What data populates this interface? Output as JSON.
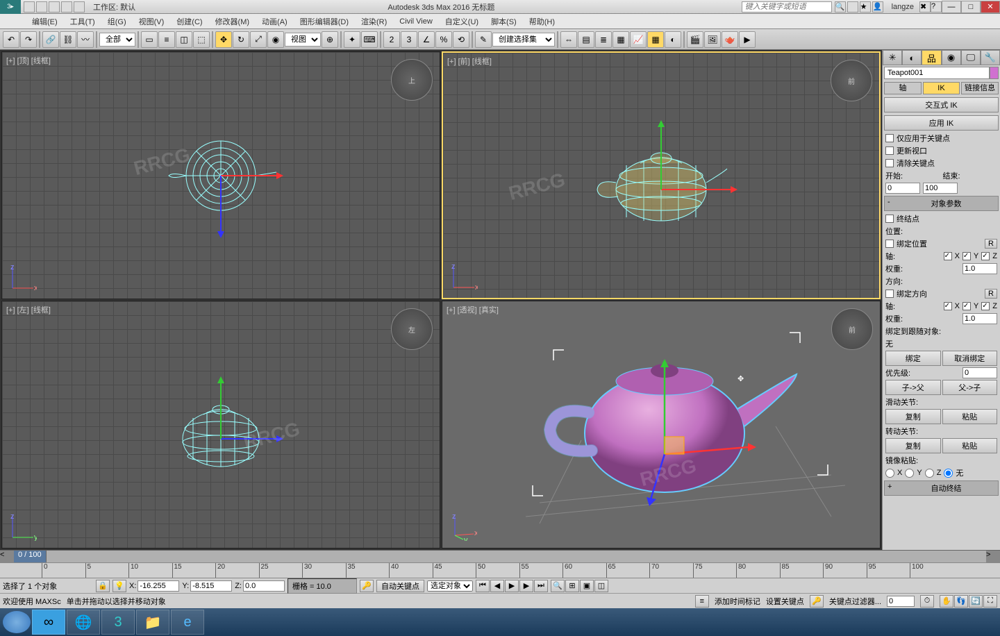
{
  "titlebar": {
    "workspace_label": "工作区: 默认",
    "app_title": "Autodesk 3ds Max 2016    无标题",
    "search_placeholder": "键入关键字或短语",
    "username": "langze"
  },
  "menu": [
    "编辑(E)",
    "工具(T)",
    "组(G)",
    "视图(V)",
    "创建(C)",
    "修改器(M)",
    "动画(A)",
    "图形编辑器(D)",
    "渲染(R)",
    "Civil View",
    "自定义(U)",
    "脚本(S)",
    "帮助(H)"
  ],
  "toolbar": {
    "filter": "全部",
    "view_dropdown": "视图",
    "selection_set": "创建选择集"
  },
  "viewports": {
    "top": "[+] [顶] [线框]",
    "front": "[+] [前] [线框]",
    "left": "[+] [左] [线框]",
    "persp": "[+] [透视] [真实]",
    "cube_front": "前",
    "cube_left": "左",
    "cube_top": "上"
  },
  "panel": {
    "object_name": "Teapot001",
    "subtabs": {
      "pivot": "轴",
      "ik": "IK",
      "link": "链接信息"
    },
    "interactive_ik": "交互式 IK",
    "apply_ik": "应用 IK",
    "only_keyframes": "仅应用于关键点",
    "update_viewport": "更新视口",
    "clear_keys": "清除关键点",
    "start": "开始:",
    "start_val": "0",
    "end": "结束:",
    "end_val": "100",
    "obj_params": "对象参数",
    "terminator": "终结点",
    "position": "位置:",
    "bind_pos": "绑定位置",
    "axis": "轴:",
    "weight": "权重:",
    "weight_val": "1.0",
    "orientation": "方向:",
    "bind_orient": "绑定方向",
    "bind_follow": "绑定到跟随对象:",
    "none": "无",
    "bind": "绑定",
    "unbind": "取消绑定",
    "priority": "优先级:",
    "priority_val": "0",
    "child_parent": "子->父",
    "parent_child": "父->子",
    "sliding_joint": "滑动关节:",
    "copy": "复制",
    "paste": "粘贴",
    "rotation_joint": "转动关节:",
    "mirror_paste": "镜像粘贴:",
    "auto_terminate": "自动终结",
    "r_btn": "R"
  },
  "timeline": {
    "current": "0 / 100",
    "ticks": [
      0,
      5,
      10,
      15,
      20,
      25,
      30,
      35,
      40,
      45,
      50,
      55,
      60,
      65,
      70,
      75,
      80,
      85,
      90,
      95,
      100
    ]
  },
  "status": {
    "selection_info": "选择了 1 个对象",
    "x": "-16.255",
    "y": "-8.515",
    "z": "0.0",
    "grid": "栅格 = 10.0",
    "auto_key": "自动关键点",
    "selected": "选定对象",
    "set_key": "设置关键点",
    "key_filter": "关键点过滤器...",
    "add_time_tag": "添加时间标记",
    "welcome": "欢迎使用 MAXSc",
    "hint": "单击并拖动以选择并移动对象"
  },
  "watermark": "RRCG"
}
